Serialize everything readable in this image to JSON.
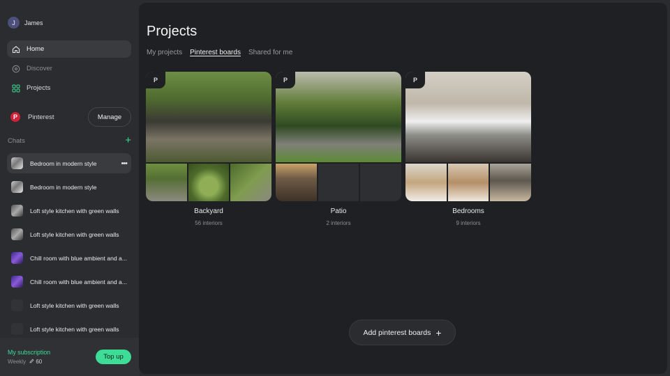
{
  "user": {
    "initial": "J",
    "name": "James"
  },
  "nav": [
    {
      "label": "Home",
      "icon": "home-icon",
      "state": "active"
    },
    {
      "label": "Discover",
      "icon": "compass-icon",
      "state": "muted"
    },
    {
      "label": "Projects",
      "icon": "grid-icon",
      "state": "normal",
      "icon_color": "#3ddc97"
    }
  ],
  "pinterest": {
    "label": "Pinterest",
    "manage_label": "Manage",
    "icon": "pinterest-icon",
    "brand_color": "#d1213a"
  },
  "chats": {
    "label": "Chats",
    "add_icon": "plus-icon",
    "items": [
      {
        "title": "Bedroom in modern style",
        "thumb": "bedroom",
        "active": true
      },
      {
        "title": "Bedroom in modern style",
        "thumb": "bedroom"
      },
      {
        "title": "Loft style kitchen with green walls",
        "thumb": "kitchen"
      },
      {
        "title": "Loft style kitchen with green walls",
        "thumb": "kitchen"
      },
      {
        "title": "Chill room with blue ambient and a...",
        "thumb": "chill"
      },
      {
        "title": "Chill room with blue ambient and a...",
        "thumb": "chill"
      },
      {
        "title": "Loft style kitchen with green walls",
        "thumb": "dark"
      },
      {
        "title": "Loft style kitchen with green walls",
        "thumb": "dark"
      }
    ]
  },
  "subscription": {
    "title": "My subscription",
    "plan": "Weekly",
    "credits": "60",
    "topup_label": "Top up",
    "accent": "#3ddc97"
  },
  "main": {
    "title": "Projects",
    "tabs": [
      {
        "label": "My projects",
        "active": false
      },
      {
        "label": "Pinterest boards",
        "active": true
      },
      {
        "label": "Shared for me",
        "active": false
      }
    ],
    "boards": [
      {
        "name": "Backyard",
        "count": "56 interiors",
        "images": [
          "yard1",
          "yard2",
          "yard3",
          "yard4"
        ]
      },
      {
        "name": "Patio",
        "count": "2 interiors",
        "images": [
          "patio1",
          "house",
          "empty",
          "empty"
        ]
      },
      {
        "name": "Bedrooms",
        "count": "9 interiors",
        "images": [
          "bed1",
          "bed2",
          "bed3",
          "bed4"
        ]
      }
    ],
    "add_button": "Add pinterest boards"
  }
}
